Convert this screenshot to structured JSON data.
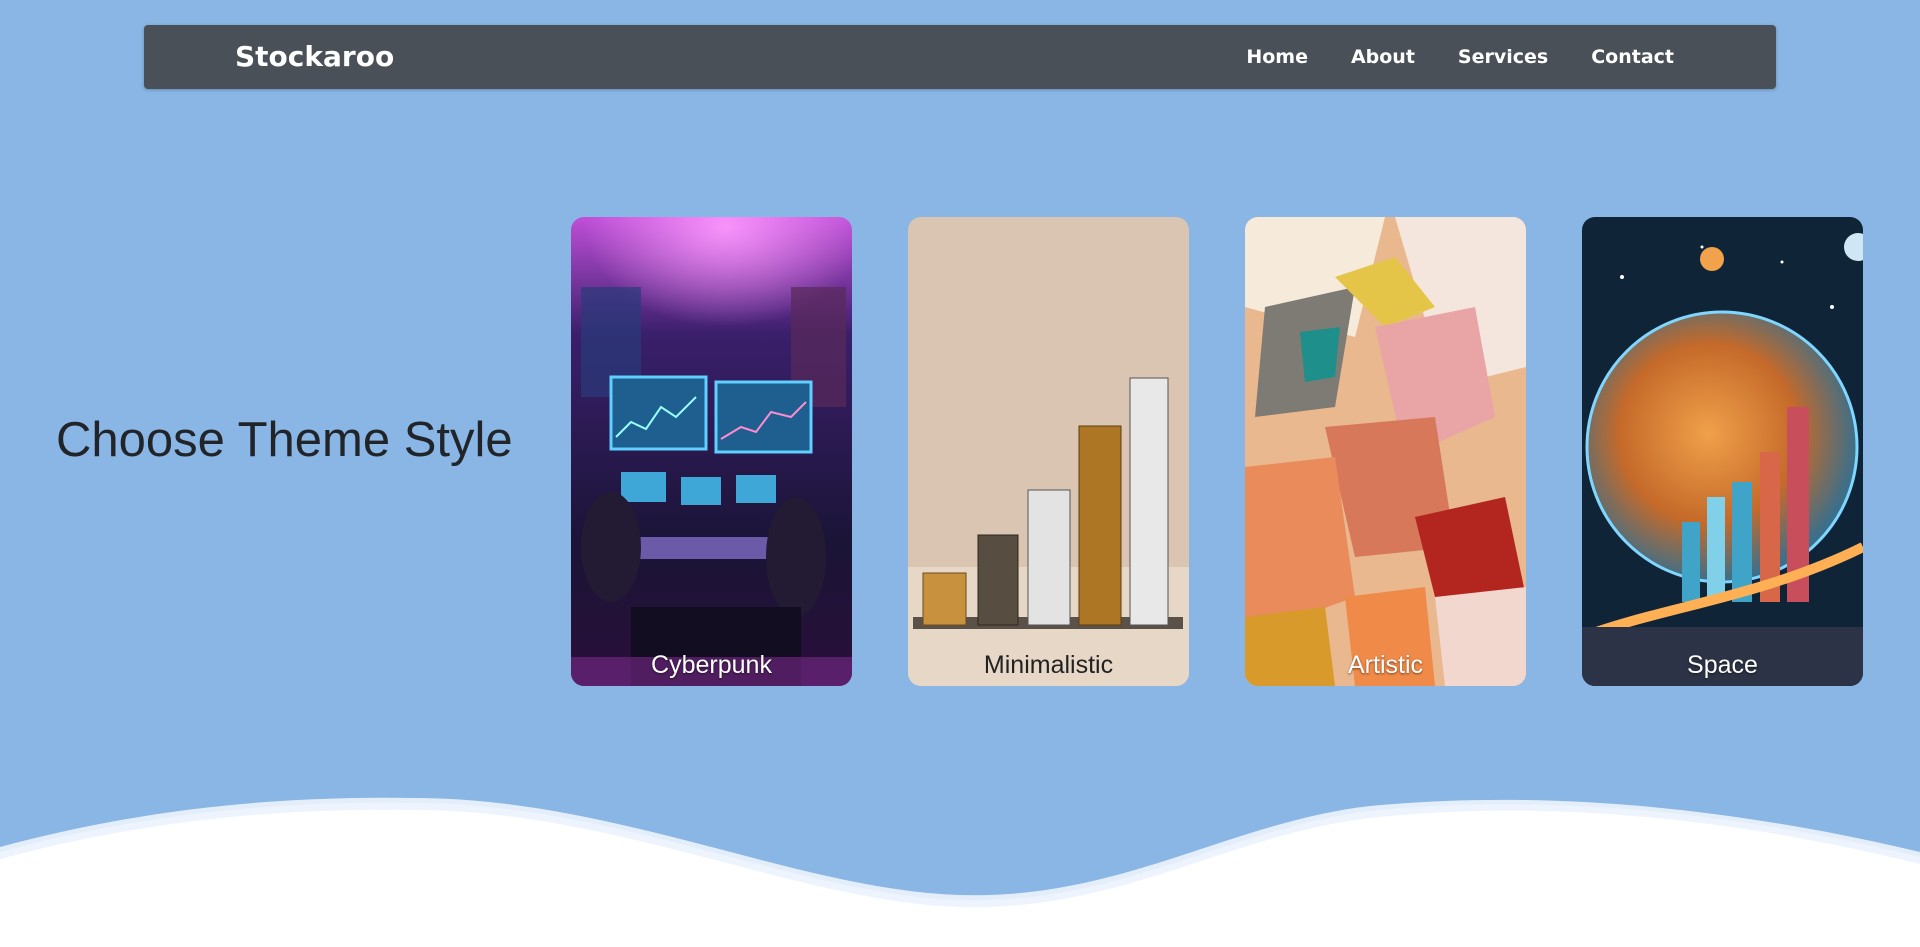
{
  "navbar": {
    "brand": "Stockaroo",
    "links": [
      {
        "label": "Home"
      },
      {
        "label": "About"
      },
      {
        "label": "Services"
      },
      {
        "label": "Contact"
      }
    ]
  },
  "hero": {
    "heading": "Choose Theme Style"
  },
  "themes": [
    {
      "label": "Cyberpunk"
    },
    {
      "label": "Minimalistic"
    },
    {
      "label": "Artistic"
    },
    {
      "label": "Space"
    }
  ],
  "colors": {
    "page_background": "#89b6e4",
    "navbar_background": "#495057",
    "heading_text": "#212529",
    "wave_white": "#ffffff"
  }
}
